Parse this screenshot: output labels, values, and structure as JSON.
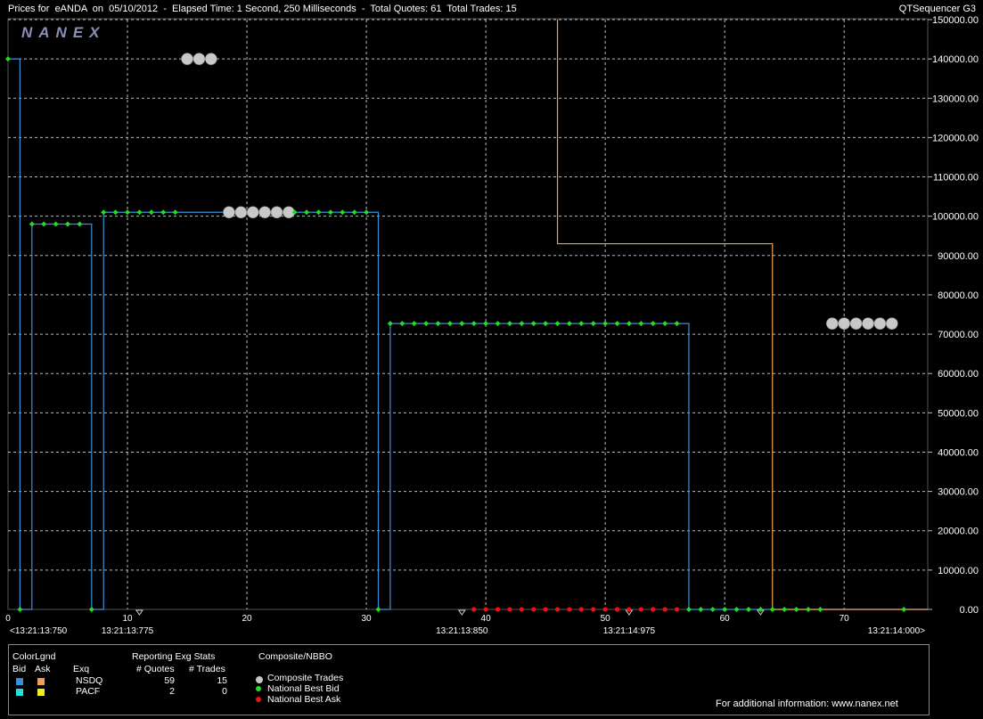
{
  "header": {
    "title": "Prices for  eANDA  on  05/10/2012  -  Elapsed Time: 1 Second, 250 Milliseconds  -  Total Quotes: 61  Total Trades: 15",
    "app_name": "QTSequencer G3",
    "logo_text": "NANEX"
  },
  "chart_data": {
    "type": "line",
    "x_axis": {
      "range": [
        0,
        77
      ],
      "ticks": [
        "0",
        "10",
        "20",
        "30",
        "40",
        "50",
        "60",
        "70"
      ],
      "tick_values": [
        0,
        10,
        20,
        30,
        40,
        50,
        60,
        70
      ],
      "time_labels": [
        {
          "x": 0,
          "label": "<13:21:13:750"
        },
        {
          "x": 10,
          "label": "13:21:13:775"
        },
        {
          "x": 38,
          "label": "13:21:13:850"
        },
        {
          "x": 52,
          "label": "13:21:14:975"
        },
        {
          "x": 76,
          "label": "13:21:14:000>"
        }
      ]
    },
    "y_axis": {
      "range": [
        0,
        150000
      ],
      "ticks": [
        "0.00",
        "10000.00",
        "20000.00",
        "30000.00",
        "40000.00",
        "50000.00",
        "60000.00",
        "70000.00",
        "80000.00",
        "90000.00",
        "100000.00",
        "110000.00",
        "120000.00",
        "130000.00",
        "140000.00",
        "150000.00"
      ],
      "tick_values": [
        0,
        10000,
        20000,
        30000,
        40000,
        50000,
        60000,
        70000,
        80000,
        90000,
        100000,
        110000,
        120000,
        130000,
        140000,
        150000
      ]
    },
    "grid": true,
    "series": [
      {
        "name": "NSDQ Bid",
        "color": "#3a8fd9",
        "x": [
          0,
          1,
          1,
          2,
          2,
          7,
          7,
          8,
          8,
          31,
          31,
          32,
          32,
          57,
          57,
          77
        ],
        "y": [
          140000,
          140000,
          0,
          0,
          98000,
          98000,
          0,
          0,
          101000,
          101000,
          0,
          0,
          72700,
          72700,
          0,
          0
        ]
      },
      {
        "name": "NSDQ Ask",
        "color": "#f0a050",
        "x": [
          46,
          46,
          64,
          64,
          77
        ],
        "y": [
          150000,
          93000,
          93000,
          0,
          0
        ]
      }
    ],
    "trades": {
      "name": "Composite Trades",
      "color": "#c8c8c8",
      "points": [
        [
          15,
          140000
        ],
        [
          16,
          140000
        ],
        [
          17,
          140000
        ],
        [
          18.5,
          101000
        ],
        [
          19.5,
          101000
        ],
        [
          20.5,
          101000
        ],
        [
          21.5,
          101000
        ],
        [
          22.5,
          101000
        ],
        [
          23.5,
          101000
        ],
        [
          69,
          72700
        ],
        [
          70,
          72700
        ],
        [
          71,
          72700
        ],
        [
          72,
          72700
        ],
        [
          73,
          72700
        ],
        [
          74,
          72700
        ]
      ]
    },
    "nbb": {
      "name": "National Best Bid",
      "color": "#22dd22",
      "points": [
        [
          0,
          140000
        ],
        [
          1,
          0
        ],
        [
          2,
          98000
        ],
        [
          3,
          98000
        ],
        [
          4,
          98000
        ],
        [
          5,
          98000
        ],
        [
          6,
          98000
        ],
        [
          7,
          0
        ],
        [
          8,
          101000
        ],
        [
          9,
          101000
        ],
        [
          10,
          101000
        ],
        [
          11,
          101000
        ],
        [
          12,
          101000
        ],
        [
          13,
          101000
        ],
        [
          14,
          101000
        ],
        [
          24,
          101000
        ],
        [
          25,
          101000
        ],
        [
          26,
          101000
        ],
        [
          27,
          101000
        ],
        [
          28,
          101000
        ],
        [
          29,
          101000
        ],
        [
          30,
          101000
        ],
        [
          31,
          0
        ],
        [
          32,
          72700
        ],
        [
          33,
          72700
        ],
        [
          34,
          72700
        ],
        [
          35,
          72700
        ],
        [
          36,
          72700
        ],
        [
          37,
          72700
        ],
        [
          38,
          72700
        ],
        [
          39,
          72700
        ],
        [
          40,
          72700
        ],
        [
          41,
          72700
        ],
        [
          42,
          72700
        ],
        [
          43,
          72700
        ],
        [
          44,
          72700
        ],
        [
          45,
          72700
        ],
        [
          46,
          72700
        ],
        [
          47,
          72700
        ],
        [
          48,
          72700
        ],
        [
          49,
          72700
        ],
        [
          50,
          72700
        ],
        [
          51,
          72700
        ],
        [
          52,
          72700
        ],
        [
          53,
          72700
        ],
        [
          54,
          72700
        ],
        [
          55,
          72700
        ],
        [
          56,
          72700
        ],
        [
          57,
          0
        ],
        [
          58,
          0
        ],
        [
          59,
          0
        ],
        [
          60,
          0
        ],
        [
          61,
          0
        ],
        [
          62,
          0
        ],
        [
          63,
          0
        ],
        [
          64,
          0
        ],
        [
          65,
          0
        ],
        [
          66,
          0
        ],
        [
          67,
          0
        ],
        [
          68,
          0
        ],
        [
          75,
          0
        ]
      ]
    },
    "nbo": {
      "name": "National Best Ask",
      "color": "#ee1111",
      "points": [
        [
          39,
          0
        ],
        [
          40,
          0
        ],
        [
          41,
          0
        ],
        [
          42,
          0
        ],
        [
          43,
          0
        ],
        [
          44,
          0
        ],
        [
          45,
          0
        ],
        [
          46,
          0
        ],
        [
          47,
          0
        ],
        [
          48,
          0
        ],
        [
          49,
          0
        ],
        [
          50,
          0
        ],
        [
          51,
          0
        ],
        [
          52,
          0
        ],
        [
          53,
          0
        ],
        [
          54,
          0
        ],
        [
          55,
          0
        ],
        [
          56,
          0
        ]
      ]
    },
    "markers": {
      "color": "#cccccc",
      "x": [
        11,
        38,
        52,
        63
      ]
    }
  },
  "legend": {
    "colorlgnd_title": "ColorLgnd",
    "bid_header": "Bid",
    "ask_header": "Ask",
    "exq_header": "Exq",
    "stats_title": "Reporting Exg Stats",
    "quotes_header": "# Quotes",
    "trades_header": "# Trades",
    "composite_title": "Composite/NBBO",
    "rows": [
      {
        "exchange": "NSDQ",
        "quotes": "59",
        "trades": "15",
        "bid_color": "#3a8fd9",
        "ask_color": "#f0a050"
      },
      {
        "exchange": "PACF",
        "quotes": "2",
        "trades": "0",
        "bid_color": "#22e0e0",
        "ask_color": "#f0f020"
      }
    ],
    "composite_items": [
      {
        "label": "Composite Trades",
        "color": "#c8c8c8"
      },
      {
        "label": "National Best Bid",
        "color": "#22dd22"
      },
      {
        "label": "National Best Ask",
        "color": "#ee1111"
      }
    ],
    "footer_text": "For additional information: www.nanex.net"
  }
}
